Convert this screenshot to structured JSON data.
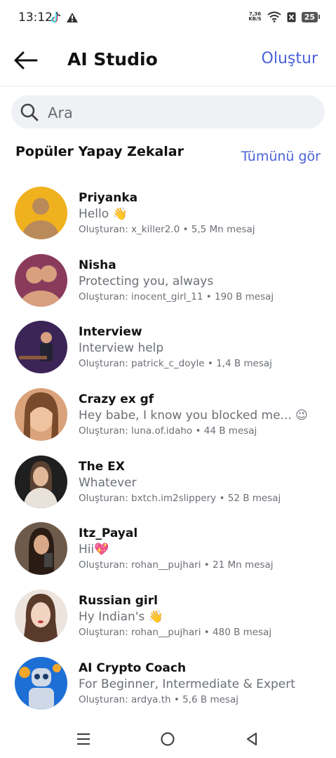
{
  "status": {
    "time": "13:12",
    "speed_value": "7,36",
    "speed_unit": "KB/S",
    "battery": "25"
  },
  "header": {
    "title": "AI Studio",
    "create_label": "Oluştur"
  },
  "search": {
    "placeholder": "Ara"
  },
  "section": {
    "title": "Popüler Yapay Zekalar",
    "see_all_label": "Tümünü gör"
  },
  "ais": [
    {
      "name": "Priyanka",
      "tagline": "Hello 👋",
      "creator": "Oluşturan: x_killer2.0",
      "messages": "5,5 Mn mesaj",
      "avatar_bg": "#f0b11e",
      "avatar_fg": "#b98a5a"
    },
    {
      "name": "Nisha",
      "tagline": "Protecting you, always",
      "creator": "Oluşturan: inocent_girl_11",
      "messages": "190 B mesaj",
      "avatar_bg": "#8a3b5c",
      "avatar_fg": "#d8a07f"
    },
    {
      "name": "Interview",
      "tagline": "Interview help",
      "creator": "Oluşturan: patrick_c_doyle",
      "messages": "1,4 B mesaj",
      "avatar_bg": "#3b2456",
      "avatar_fg": "#222233"
    },
    {
      "name": "Crazy ex gf",
      "tagline": "Hey babe, I know you blocked me... 😉",
      "creator": "Oluşturan: luna.of.idaho",
      "messages": "44 B mesaj",
      "avatar_bg": "#d9a27a",
      "avatar_fg": "#7a4a2c"
    },
    {
      "name": "The EX",
      "tagline": "Whatever",
      "creator": "Oluşturan: bxtch.im2slippery",
      "messages": "52 B mesaj",
      "avatar_bg": "#1f1f1f",
      "avatar_fg": "#e8e2da"
    },
    {
      "name": "Itz_Payal",
      "tagline": "Hii💖",
      "creator": "Oluşturan: rohan__pujhari",
      "messages": "21 Mn mesaj",
      "avatar_bg": "#6e5a4a",
      "avatar_fg": "#2a1c14"
    },
    {
      "name": "Russian girl",
      "tagline": "Hy Indian's 👋",
      "creator": "Oluşturan: rohan__pujhari",
      "messages": "480 B mesaj",
      "avatar_bg": "#ece4dd",
      "avatar_fg": "#5a3a2a"
    },
    {
      "name": "AI Crypto Coach",
      "tagline": "For Beginner, Intermediate & Expert",
      "creator": "Oluşturan: ardya.th",
      "messages": "5,6 B mesaj",
      "avatar_bg": "#1d6fd6",
      "avatar_fg": "#cfd8e6"
    }
  ],
  "separator": "•",
  "colors": {
    "accent": "#4a63d9",
    "secondary_text": "#6b6f75",
    "search_bg": "#eff1f4"
  },
  "icons": [
    "back-arrow-icon",
    "search-icon",
    "menu-icon",
    "home-icon",
    "back-triangle-icon",
    "wifi-icon",
    "tiktok-icon",
    "warning-icon"
  ]
}
